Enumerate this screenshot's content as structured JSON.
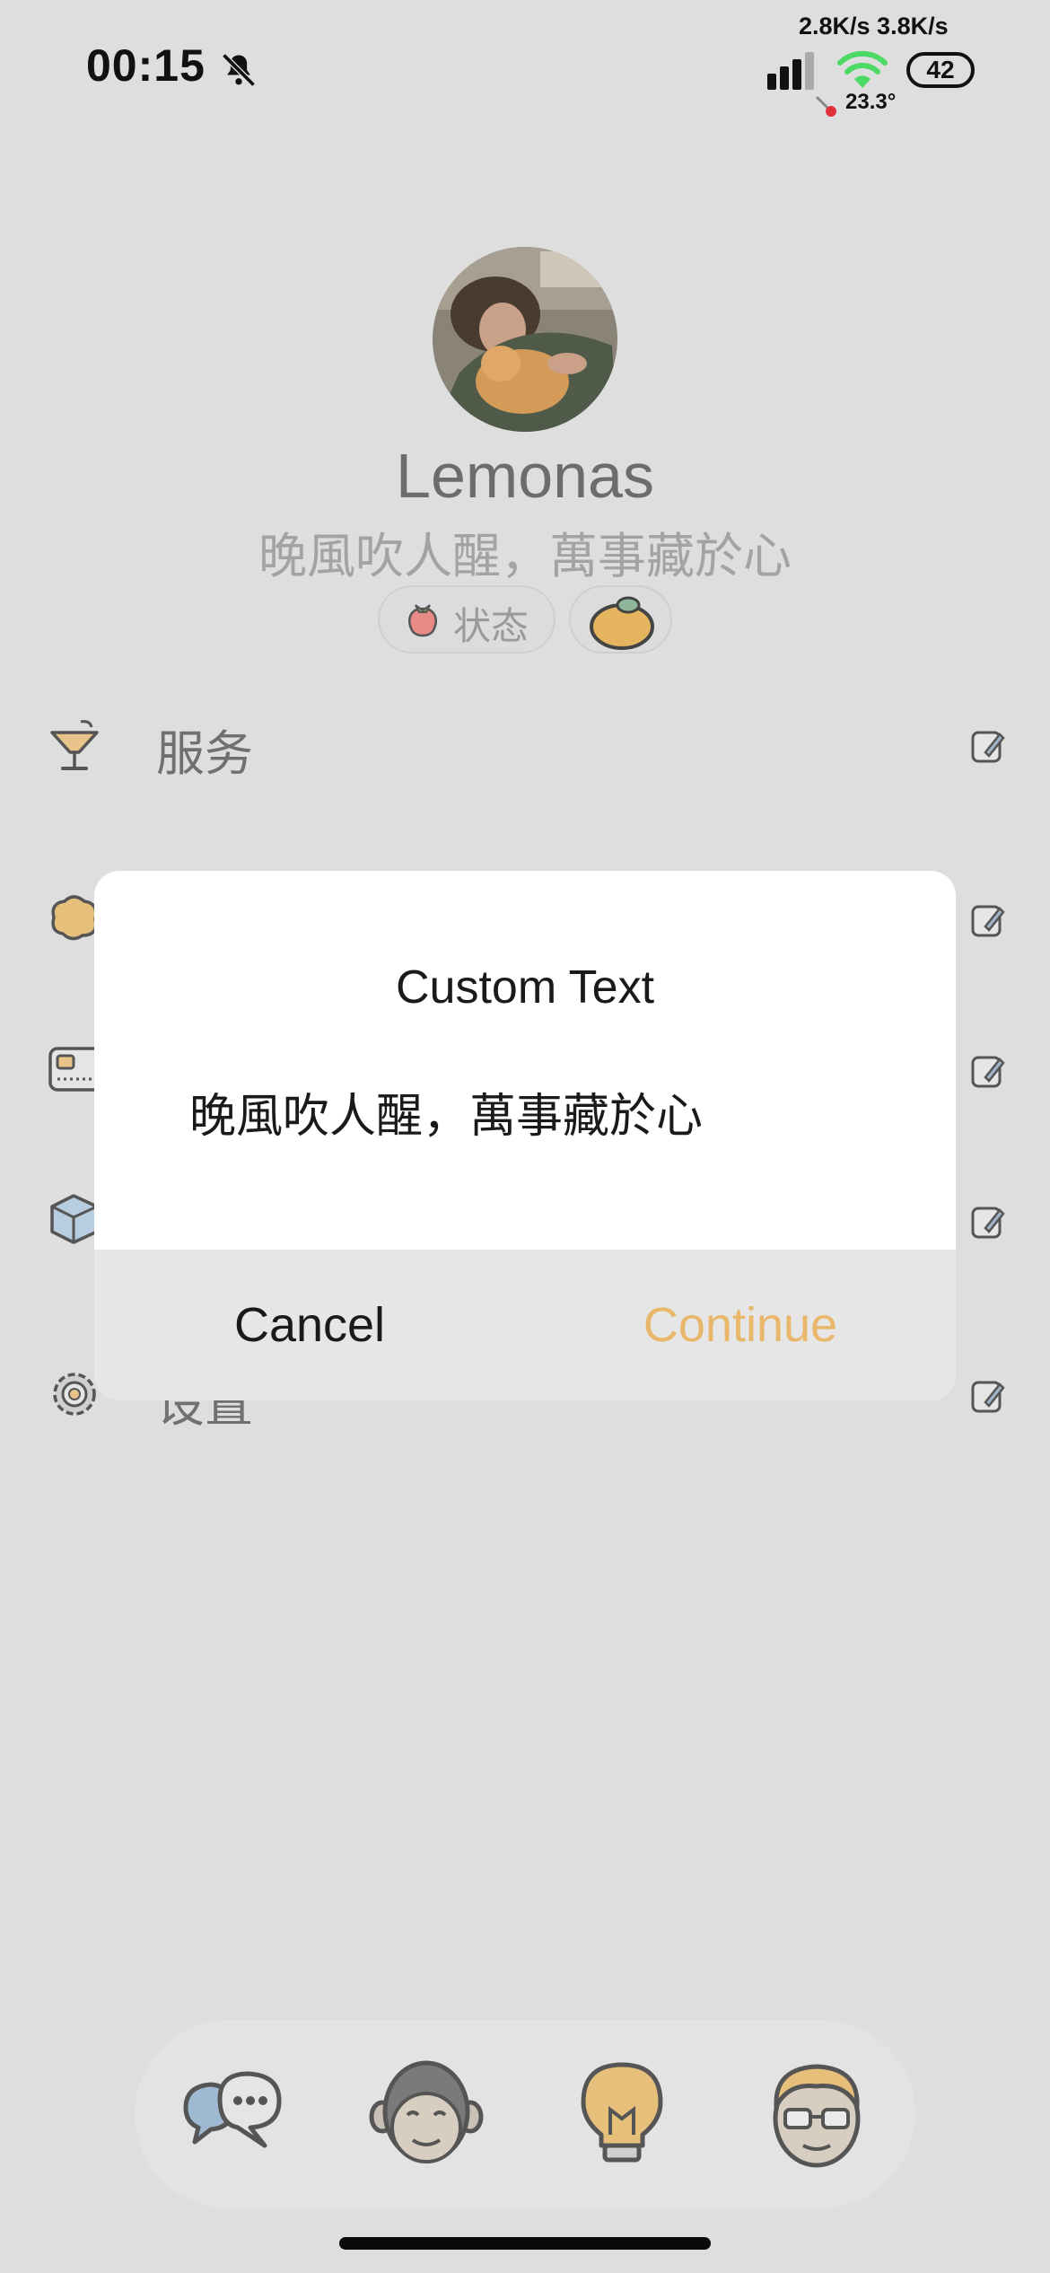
{
  "status_bar": {
    "time": "00:15",
    "net_speed": "2.8K/s 3.8K/s",
    "battery": "42",
    "temperature": "23.3°"
  },
  "profile": {
    "username": "Lemonas",
    "bio": "晚風吹人醒，萬事藏於心",
    "status_chip_label": "状态"
  },
  "menu": {
    "items": [
      {
        "label": "服务",
        "icon": "cocktail-icon"
      },
      {
        "label": "",
        "icon": "cookie-icon"
      },
      {
        "label": "",
        "icon": "card-icon"
      },
      {
        "label": "",
        "icon": "box-icon"
      },
      {
        "label": "设置",
        "icon": "gear-icon"
      }
    ]
  },
  "dialog": {
    "title": "Custom Text",
    "input_value": "晚風吹人醒，萬事藏於心",
    "cancel_label": "Cancel",
    "continue_label": "Continue"
  },
  "tab_bar": {
    "tabs": [
      {
        "icon": "chat-bubbles-icon"
      },
      {
        "icon": "monkey-face-icon"
      },
      {
        "icon": "lightbulb-icon"
      },
      {
        "icon": "person-glasses-icon"
      }
    ]
  },
  "colors": {
    "accent": "#e8b76a",
    "background": "#dedede",
    "dialog_bg": "#ffffff"
  }
}
